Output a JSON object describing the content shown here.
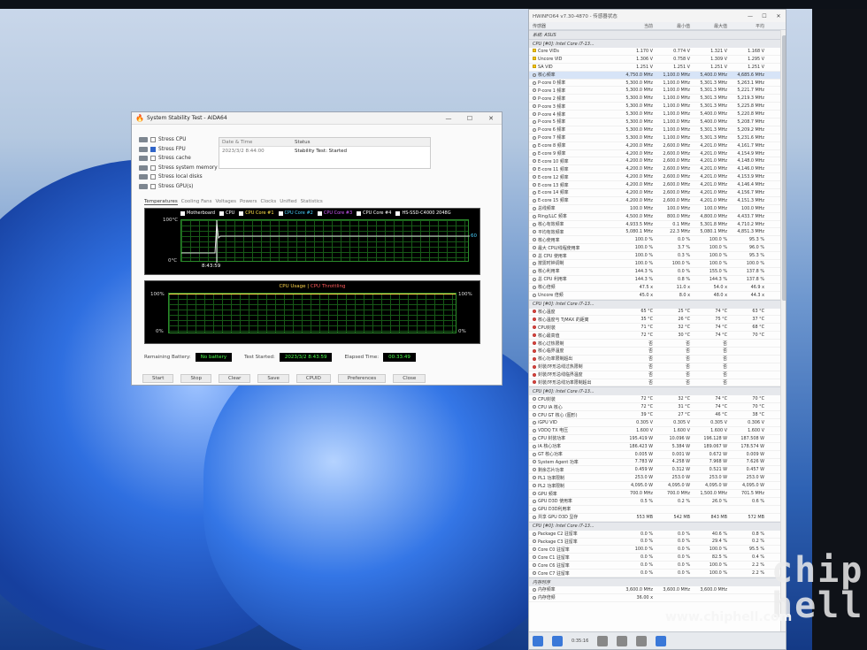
{
  "aida": {
    "title": "System Stability Test - AIDA64",
    "window_controls": [
      "—",
      "☐",
      "✕"
    ],
    "options": [
      {
        "label": "Stress CPU",
        "checked": false
      },
      {
        "label": "Stress FPU",
        "checked": true
      },
      {
        "label": "Stress cache",
        "checked": false
      },
      {
        "label": "Stress system memory",
        "checked": false
      },
      {
        "label": "Stress local disks",
        "checked": false
      },
      {
        "label": "Stress GPU(s)",
        "checked": false
      }
    ],
    "table": {
      "col1": "Date & Time",
      "col2": "Status",
      "date": "2023/3/2 8:44:00",
      "status": "Stability Test: Started"
    },
    "tabs": [
      "Temperatures",
      "Cooling Fans",
      "Voltages",
      "Powers",
      "Clocks",
      "Unified",
      "Statistics"
    ],
    "legend": [
      "Motherboard",
      "CPU",
      "CPU Core #1",
      "CPU Core #2",
      "CPU Core #3",
      "CPU Core #4",
      "HS-SSD-C4000 2048G"
    ],
    "legend_colors": [
      "#ffffff",
      "#ffffff",
      "#ffe14a",
      "#4ad2ff",
      "#d35cff",
      "#ffffff",
      "#ffffff"
    ],
    "temp_top": "100°C",
    "temp_bottom": "0°C",
    "temp_time": "8:43:59",
    "temp_value": "60",
    "usage_title_a": "CPU Usage",
    "usage_sep": "|",
    "usage_title_b": "CPU Throttling",
    "usage_top": "100%",
    "usage_bottom": "0%",
    "usage_right_top": "100%",
    "usage_right_bottom": "0%",
    "battery_label": "Remaining Battery:",
    "battery_value": "No battery",
    "started_label": "Test Started:",
    "started_value": "2023/3/2 8:43:59",
    "elapsed_label": "Elapsed Time:",
    "elapsed_value": "00:33:49",
    "buttons": [
      "Start",
      "Stop",
      "Clear",
      "Save",
      "CPUID",
      "Preferences",
      "Close"
    ]
  },
  "hwinfo": {
    "title": "HWiNFO64 v7.30-4870 - 传感器状态",
    "window_controls": [
      "—",
      "☐",
      "✕"
    ],
    "headers": [
      "传感器",
      "当前",
      "最小值",
      "最大值",
      "平均"
    ],
    "groups": [
      {
        "name": "系统: ASUS",
        "rows": []
      },
      {
        "name": "CPU [#0]: Intel Core i7-13...",
        "rows": [
          [
            "Core VIDs",
            "1.170 V",
            "0.774 V",
            "1.321 V",
            "1.168 V"
          ],
          [
            "Uncore VID",
            "1.306 V",
            "0.758 V",
            "1.309 V",
            "1.295 V"
          ],
          [
            "SA VID",
            "1.251 V",
            "1.251 V",
            "1.251 V",
            "1.251 V"
          ],
          [
            "核心频率",
            "4,750.0 MHz",
            "1,100.0 MHz",
            "5,400.0 MHz",
            "4,685.6 MHz"
          ],
          [
            "P-core 0 频率",
            "5,300.0 MHz",
            "1,100.0 MHz",
            "5,301.3 MHz",
            "5,263.1 MHz"
          ],
          [
            "P-core 1 频率",
            "5,300.0 MHz",
            "1,100.0 MHz",
            "5,301.3 MHz",
            "5,221.7 MHz"
          ],
          [
            "P-core 2 频率",
            "5,300.0 MHz",
            "1,100.0 MHz",
            "5,301.3 MHz",
            "5,219.3 MHz"
          ],
          [
            "P-core 3 频率",
            "5,300.0 MHz",
            "1,100.0 MHz",
            "5,301.3 MHz",
            "5,225.8 MHz"
          ],
          [
            "P-core 4 频率",
            "5,300.0 MHz",
            "1,100.0 MHz",
            "5,400.0 MHz",
            "5,220.8 MHz"
          ],
          [
            "P-core 5 频率",
            "5,300.0 MHz",
            "1,100.0 MHz",
            "5,400.0 MHz",
            "5,208.7 MHz"
          ],
          [
            "P-core 6 频率",
            "5,300.0 MHz",
            "1,100.0 MHz",
            "5,301.3 MHz",
            "5,209.2 MHz"
          ],
          [
            "P-core 7 频率",
            "5,300.0 MHz",
            "1,100.0 MHz",
            "5,301.3 MHz",
            "5,231.6 MHz"
          ],
          [
            "E-core 8 频率",
            "4,200.0 MHz",
            "2,600.0 MHz",
            "4,201.0 MHz",
            "4,161.7 MHz"
          ],
          [
            "E-core 9 频率",
            "4,200.0 MHz",
            "2,600.0 MHz",
            "4,201.0 MHz",
            "4,154.9 MHz"
          ],
          [
            "E-core 10 频率",
            "4,200.0 MHz",
            "2,600.0 MHz",
            "4,201.0 MHz",
            "4,148.0 MHz"
          ],
          [
            "E-core 11 频率",
            "4,200.0 MHz",
            "2,600.0 MHz",
            "4,201.0 MHz",
            "4,146.0 MHz"
          ],
          [
            "E-core 12 频率",
            "4,200.0 MHz",
            "2,600.0 MHz",
            "4,201.0 MHz",
            "4,153.9 MHz"
          ],
          [
            "E-core 13 频率",
            "4,200.0 MHz",
            "2,600.0 MHz",
            "4,201.0 MHz",
            "4,146.4 MHz"
          ],
          [
            "E-core 14 频率",
            "4,200.0 MHz",
            "2,600.0 MHz",
            "4,201.0 MHz",
            "4,156.7 MHz"
          ],
          [
            "E-core 15 频率",
            "4,200.0 MHz",
            "2,600.0 MHz",
            "4,201.0 MHz",
            "4,151.3 MHz"
          ],
          [
            "总线频率",
            "100.0 MHz",
            "100.0 MHz",
            "100.0 MHz",
            "100.0 MHz"
          ],
          [
            "Ring/LLC 频率",
            "4,500.0 MHz",
            "800.0 MHz",
            "4,800.0 MHz",
            "4,433.7 MHz"
          ],
          [
            "核心有效频率",
            "4,933.5 MHz",
            "0.1 MHz",
            "5,301.8 MHz",
            "4,710.2 MHz"
          ],
          [
            "平均有效频率",
            "5,080.1 MHz",
            "22.3 MHz",
            "5,080.1 MHz",
            "4,851.3 MHz"
          ],
          [
            "核心使用率",
            "100.0 %",
            "0.0 %",
            "100.0 %",
            "95.3 %"
          ],
          [
            "最大 CPU/线程使用率",
            "100.0 %",
            "3.7 %",
            "100.0 %",
            "96.0 %"
          ],
          [
            "总 CPU 使用率",
            "100.0 %",
            "0.3 %",
            "100.0 %",
            "95.3 %"
          ],
          [
            "按需时钟调制",
            "100.0 %",
            "100.0 %",
            "100.0 %",
            "100.0 %"
          ],
          [
            "核心利用率",
            "144.3 %",
            "0.0 %",
            "155.0 %",
            "137.8 %"
          ],
          [
            "总 CPU 利用率",
            "144.3 %",
            "0.8 %",
            "144.3 %",
            "137.8 %"
          ],
          [
            "核心倍频",
            "47.5 x",
            "11.0 x",
            "54.0 x",
            "46.9 x"
          ],
          [
            "Uncore 倍频",
            "45.0 x",
            "8.0 x",
            "48.0 x",
            "44.3 x"
          ]
        ]
      },
      {
        "name": "CPU [#0]: Intel Core i7-13...",
        "rows": [
          [
            "核心温度",
            "65 °C",
            "25 °C",
            "74 °C",
            "63 °C"
          ],
          [
            "核心温度与 TjMAX 的距离",
            "35 °C",
            "26 °C",
            "75 °C",
            "37 °C"
          ],
          [
            "CPU封装",
            "71 °C",
            "32 °C",
            "74 °C",
            "68 °C"
          ],
          [
            "核心最高值",
            "72 °C",
            "30 °C",
            "74 °C",
            "70 °C"
          ],
          [
            "核心过热限制",
            "否",
            "否",
            "否",
            ""
          ],
          [
            "核心临界温度",
            "否",
            "否",
            "否",
            ""
          ],
          [
            "核心功率限制超出",
            "否",
            "否",
            "否",
            ""
          ],
          [
            "封装/环形总线过热限制",
            "否",
            "否",
            "否",
            ""
          ],
          [
            "封装/环形总线临界温度",
            "否",
            "否",
            "否",
            ""
          ],
          [
            "封装/环形总线功率限制超出",
            "否",
            "否",
            "否",
            ""
          ]
        ]
      },
      {
        "name": "CPU [#0]: Intel Core i7-13...",
        "rows": [
          [
            "CPU封装",
            "72 °C",
            "32 °C",
            "74 °C",
            "70 °C"
          ],
          [
            "CPU IA 核心",
            "72 °C",
            "31 °C",
            "74 °C",
            "70 °C"
          ],
          [
            "CPU GT 核心 (图形)",
            "39 °C",
            "27 °C",
            "46 °C",
            "38 °C"
          ],
          [
            "iGPU VID",
            "0.305 V",
            "0.305 V",
            "0.305 V",
            "0.306 V"
          ],
          [
            "VDDQ TX 电压",
            "1.600 V",
            "1.600 V",
            "1.600 V",
            "1.600 V"
          ],
          [
            "CPU 封装功率",
            "195.419 W",
            "10.096 W",
            "196.128 W",
            "187.508 W"
          ],
          [
            "IA 核心功率",
            "186.423 W",
            "5.384 W",
            "189.067 W",
            "178.574 W"
          ],
          [
            "GT 核心功率",
            "0.005 W",
            "0.001 W",
            "0.672 W",
            "0.009 W"
          ],
          [
            "System Agent 功率",
            "7.783 W",
            "4.258 W",
            "7.968 W",
            "7.626 W"
          ],
          [
            "剩余芯片功率",
            "0.459 W",
            "0.312 W",
            "0.521 W",
            "0.457 W"
          ],
          [
            "PL1 功率限制",
            "253.0 W",
            "253.0 W",
            "253.0 W",
            "253.0 W"
          ],
          [
            "PL2 功率限制",
            "4,095.0 W",
            "4,095.0 W",
            "4,095.0 W",
            "4,095.0 W"
          ],
          [
            "GPU 频率",
            "700.0 MHz",
            "700.0 MHz",
            "1,500.0 MHz",
            "701.5 MHz"
          ],
          [
            "GPU D3D 使用率",
            "0.5 %",
            "0.2 %",
            "26.0 %",
            "0.6 %"
          ],
          [
            "GPU D3D利用率",
            "",
            "",
            "",
            ""
          ],
          [
            "共享 GPU D3D 显存",
            "553 MB",
            "542 MB",
            "843 MB",
            "572 MB"
          ]
        ]
      },
      {
        "name": "CPU [#0]: Intel Core i7-13...",
        "rows": [
          [
            "Package C2 驻留率",
            "0.0 %",
            "0.0 %",
            "40.6 %",
            "0.8 %"
          ],
          [
            "Package C3 驻留率",
            "0.0 %",
            "0.0 %",
            "29.4 %",
            "0.2 %"
          ],
          [
            "Core C0 驻留率",
            "100.0 %",
            "0.0 %",
            "100.0 %",
            "95.5 %"
          ],
          [
            "Core C1 驻留率",
            "0.0 %",
            "0.0 %",
            "82.5 %",
            "0.4 %"
          ],
          [
            "Core C6 驻留率",
            "0.0 %",
            "0.0 %",
            "100.0 %",
            "2.2 %"
          ],
          [
            "Core C7 驻留率",
            "0.0 %",
            "0.0 %",
            "100.0 %",
            "2.2 %"
          ]
        ]
      },
      {
        "name": "内存时序",
        "rows": [
          [
            "内存频率",
            "3,600.0 MHz",
            "3,600.0 MHz",
            "3,600.0 MHz",
            ""
          ],
          [
            "内存倍频",
            "36.00 x",
            "",
            "",
            ""
          ]
        ]
      }
    ],
    "bottom_time": "0:35:16"
  },
  "watermark": {
    "logo": "chip hell",
    "url": "www.chiphell.com"
  }
}
